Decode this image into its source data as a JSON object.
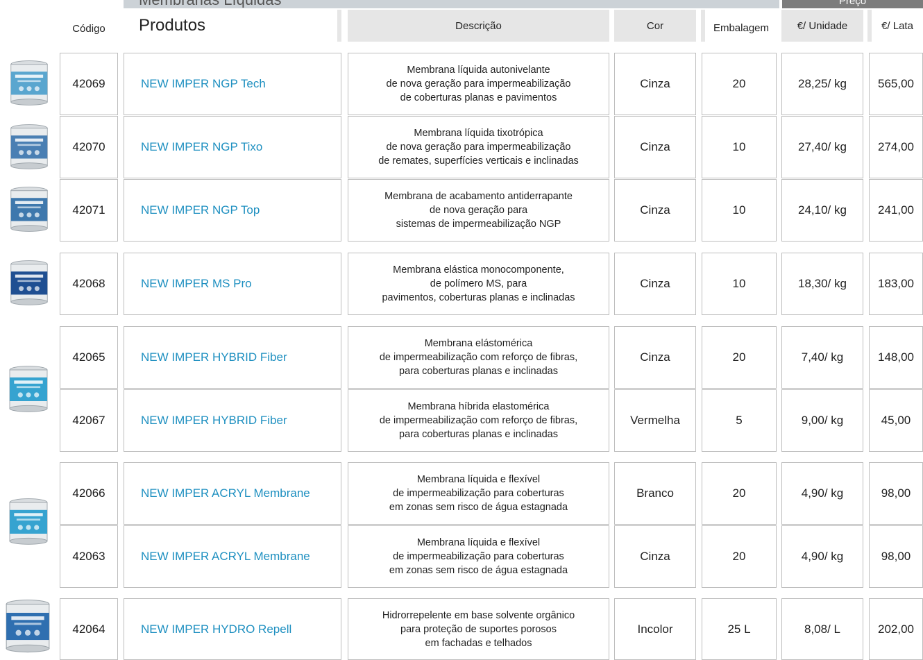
{
  "section_title": "Membranas Líquidas",
  "price_group_label": "Preço",
  "columns": {
    "codigo": "Código",
    "produtos": "Produtos",
    "descricao": "Descrição",
    "cor": "Cor",
    "embalagem": "Embalagem",
    "unidade": "€/ Unidade",
    "lata": "€/ Lata"
  },
  "rows": [
    {
      "codigo": "42069",
      "produto": "NEW IMPER NGP Tech",
      "desc": [
        "Membrana líquida autonivelante",
        "de nova geração para impermeabilização",
        "de coberturas planas e pavimentos"
      ],
      "cor": "Cinza",
      "embalagem": "20",
      "unidade": "28,25/ kg",
      "lata": "565,00"
    },
    {
      "codigo": "42070",
      "produto": "NEW IMPER NGP Tixo",
      "desc": [
        "Membrana líquida tixotrópica",
        "de nova geração para impermeabilização",
        "de remates, superfícies verticais e inclinadas"
      ],
      "cor": "Cinza",
      "embalagem": "10",
      "unidade": "27,40/ kg",
      "lata": "274,00"
    },
    {
      "codigo": "42071",
      "produto": "NEW IMPER NGP Top",
      "desc": [
        "Membrana de acabamento antiderrapante",
        "de nova geração para",
        "sistemas de impermeabilização NGP"
      ],
      "cor": "Cinza",
      "embalagem": "10",
      "unidade": "24,10/ kg",
      "lata": "241,00"
    },
    {
      "codigo": "42068",
      "produto": "NEW IMPER MS Pro",
      "desc": [
        "Membrana elástica monocomponente,",
        "de polímero MS, para",
        "pavimentos, coberturas planas e inclinadas"
      ],
      "cor": "Cinza",
      "embalagem": "10",
      "unidade": "18,30/ kg",
      "lata": "183,00"
    },
    {
      "codigo": "42065",
      "produto": "NEW IMPER HYBRID Fiber",
      "desc": [
        "Membrana elástomérica",
        "de impermeabilização com reforço de fibras,",
        "para coberturas planas e inclinadas"
      ],
      "cor": "Cinza",
      "embalagem": "20",
      "unidade": "7,40/ kg",
      "lata": "148,00"
    },
    {
      "codigo": "42067",
      "produto": "NEW IMPER HYBRID Fiber",
      "desc": [
        "Membrana híbrida elastomérica",
        "de impermeabilização com reforço de fibras,",
        "para coberturas planas e inclinadas"
      ],
      "cor": "Vermelha",
      "embalagem": "5",
      "unidade": "9,00/ kg",
      "lata": "45,00"
    },
    {
      "codigo": "42066",
      "produto": "NEW IMPER ACRYL Membrane",
      "desc": [
        "Membrana líquida e flexível",
        "de impermeabilização para coberturas",
        "em zonas sem risco de água estagnada"
      ],
      "cor": "Branco",
      "embalagem": "20",
      "unidade": "4,90/ kg",
      "lata": "98,00"
    },
    {
      "codigo": "42063",
      "produto": "NEW IMPER ACRYL Membrane",
      "desc": [
        "Membrana líquida e flexível",
        "de impermeabilização para coberturas",
        "em zonas sem risco de água estagnada"
      ],
      "cor": "Cinza",
      "embalagem": "20",
      "unidade": "4,90/ kg",
      "lata": "98,00"
    },
    {
      "codigo": "42064",
      "produto": "NEW IMPER HYDRO Repell",
      "desc": [
        "Hidrorrepelente em base solvente orgânico",
        "para proteção de suportes porosos",
        "em fachadas e telhados"
      ],
      "cor": "Incolor",
      "embalagem": "25 L",
      "unidade": "8,08/ L",
      "lata": "202,00"
    }
  ],
  "colors": {
    "product_link": "#1d8fc0",
    "header_bg": "#e6e6e6",
    "price_bar": "#7c7c7c",
    "cell_border": "#bdbdbd"
  },
  "product_images": [
    {
      "icon": "paint-can-icon",
      "color": "#5aa6cf"
    },
    {
      "icon": "paint-can-icon",
      "color": "#4a7fb3"
    },
    {
      "icon": "paint-can-icon",
      "color": "#3e78ad"
    },
    {
      "icon": "paint-can-icon",
      "color": "#1f4f92"
    },
    {
      "icon": "paint-can-icon",
      "color": "#36a3d0"
    },
    {
      "icon": "paint-can-icon",
      "color": "#36a3d0"
    },
    {
      "icon": "paint-can-icon",
      "color": "#2f6fb0"
    }
  ]
}
